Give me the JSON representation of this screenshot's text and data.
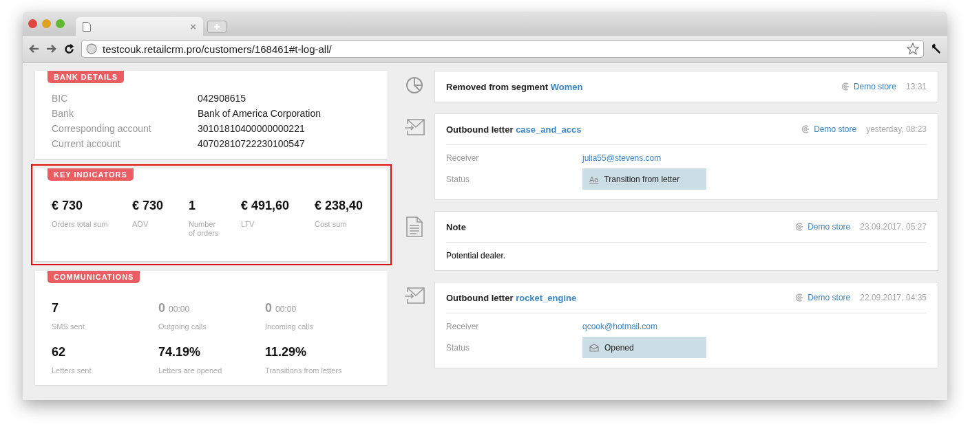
{
  "browser": {
    "tab_close": "×",
    "url": "testcouk.retailcrm.pro/customers/168461#t-log-all/"
  },
  "bank_details": {
    "title": "BANK DETAILS",
    "rows": [
      {
        "label": "BIC",
        "value": "042908615"
      },
      {
        "label": "Bank",
        "value": "Bank of America Corporation"
      },
      {
        "label": "Corresponding account",
        "value": "30101810400000000221"
      },
      {
        "label": "Current account",
        "value": "40702810722230100547"
      }
    ]
  },
  "key_indicators": {
    "title": "KEY INDICATORS",
    "highlighted": true,
    "items": [
      {
        "value": "€ 730",
        "label": "Orders total sum"
      },
      {
        "value": "€ 730",
        "label": "AOV"
      },
      {
        "value": "1",
        "label": "Number of orders"
      },
      {
        "value": "€ 491,60",
        "label": "LTV"
      },
      {
        "value": "€ 238,40",
        "label": "Cost sum"
      }
    ]
  },
  "communications": {
    "title": "COMMUNICATIONS",
    "items": [
      {
        "value": "7",
        "label": "SMS sent",
        "dimmed": false
      },
      {
        "value": "0",
        "extra": "00:00",
        "label": "Outgoing calls",
        "dimmed": true
      },
      {
        "value": "0",
        "extra": "00:00",
        "label": "Incoming calls",
        "dimmed": true
      },
      {
        "value": "62",
        "label": "Letters sent",
        "dimmed": false
      },
      {
        "value": "74.19%",
        "label": "Letters are opened",
        "dimmed": false
      },
      {
        "value": "11.29%",
        "label": "Transitions from letters",
        "dimmed": false
      }
    ]
  },
  "events": [
    {
      "kind": "segment",
      "title": "Removed from segment",
      "link": "Women",
      "store": "Demo store",
      "time": "13:31"
    },
    {
      "kind": "letter",
      "title": "Outbound letter",
      "link": "case_and_accs",
      "store": "Demo store",
      "time": "yesterday, 08:23",
      "receiver_label": "Receiver",
      "receiver": "julia55@stevens.com",
      "status_label": "Status",
      "status": {
        "kind": "letters",
        "icon_text": "Aa",
        "label": "Transition from letter"
      }
    },
    {
      "kind": "note",
      "title": "Note",
      "store": "Demo store",
      "time": "23.09.2017, 05:27",
      "body": "Potential dealer."
    },
    {
      "kind": "letter",
      "title": "Outbound letter",
      "link": "rocket_engine",
      "store": "Demo store",
      "time": "22.09.2017, 04:35",
      "receiver_label": "Receiver",
      "receiver": "qcook@hotmail.com",
      "status_label": "Status",
      "status": {
        "kind": "envelope",
        "label": "Opened"
      }
    }
  ]
}
